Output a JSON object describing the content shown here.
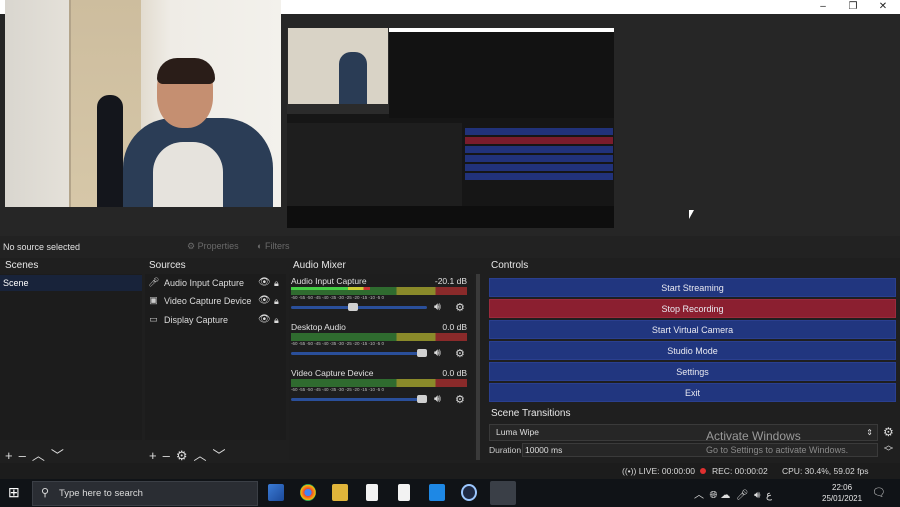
{
  "window": {
    "minimize_glyph": "–",
    "maximize_glyph": "❐",
    "close_glyph": "✕"
  },
  "panel_bar": {
    "no_source": "No source selected",
    "properties": "Properties",
    "filters": "Filters"
  },
  "scenes": {
    "title": "Scenes",
    "items": [
      "Scene"
    ]
  },
  "sources": {
    "title": "Sources",
    "items": [
      {
        "label": "Audio Input Capture",
        "icon": "microphone-icon"
      },
      {
        "label": "Video Capture Device",
        "icon": "camera-icon"
      },
      {
        "label": "Display Capture",
        "icon": "monitor-icon"
      }
    ]
  },
  "mixer": {
    "title": "Audio Mixer",
    "channels": [
      {
        "name": "Audio Input Capture",
        "db": "-20.1 dB",
        "level": 0.45,
        "volume": 0.45
      },
      {
        "name": "Desktop Audio",
        "db": "0.0 dB",
        "level": 0.0,
        "volume": 1.0
      },
      {
        "name": "Video Capture Device",
        "db": "0.0 dB",
        "level": 0.0,
        "volume": 1.0
      }
    ],
    "ticks": "-60 -55 -50 -45 -40 -35 -30 -25 -20 -15 -10 -5 0"
  },
  "controls": {
    "title": "Controls",
    "buttons": [
      "Start Streaming",
      "Stop Recording",
      "Start Virtual Camera",
      "Studio Mode",
      "Settings",
      "Exit"
    ]
  },
  "transitions": {
    "title": "Scene Transitions",
    "selected": "Luma Wipe",
    "duration_label": "Duration",
    "duration_value": "10000 ms"
  },
  "watermark": {
    "title": "Activate Windows",
    "subtitle": "Go to Settings to activate Windows."
  },
  "status": {
    "live": "LIVE: 00:00:00",
    "rec": "REC: 00:00:02",
    "cpu": "CPU: 30.4%, 59.02 fps"
  },
  "taskbar": {
    "search_placeholder": "Type here to search",
    "time": "22:06",
    "date": "25/01/2021"
  },
  "colors": {
    "accent_blue": "#21367f",
    "record_red": "#8b1f30"
  }
}
